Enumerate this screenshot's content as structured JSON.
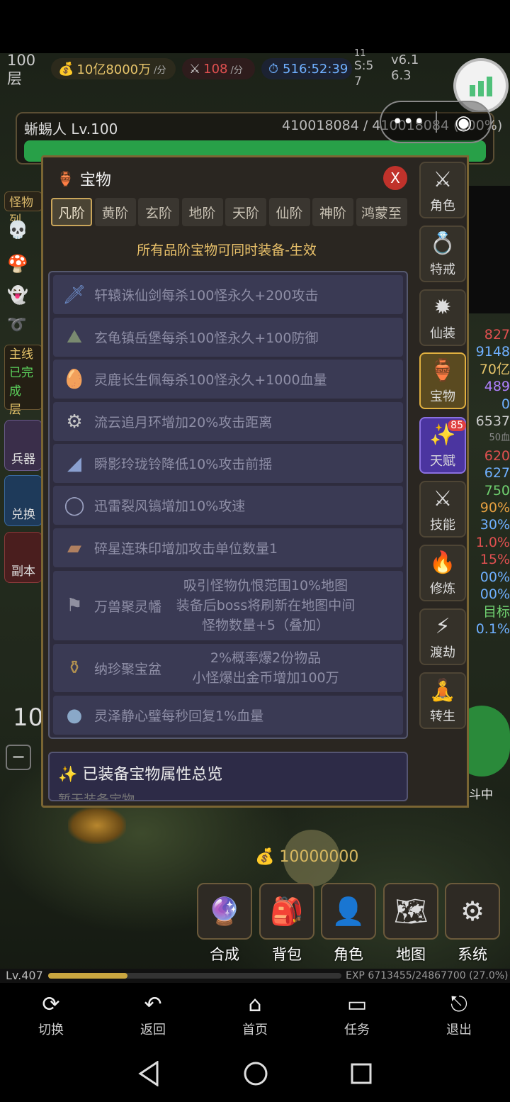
{
  "hud": {
    "floor": "100",
    "floor_unit": "层",
    "gold_rate": "10亿8000万",
    "gold_rate_unit": "/分",
    "kill_rate": "108",
    "kill_rate_unit": "/分",
    "timer": "516:52:39",
    "counter_top": "11",
    "counter_s": "S:5",
    "counter_bottom": "7",
    "version": "v6.1",
    "version2": "6.3"
  },
  "boss": {
    "name": "蜥蜴人 Lv.100",
    "hp_current": "410018084",
    "hp_max": "410018084",
    "hp_percent": "(100%)",
    "hp_fraction": 1.0
  },
  "left_side": {
    "monster_tab": "怪物列",
    "quest_title": "主线",
    "quest_status": "已完成",
    "quest_floor": "层",
    "weapon_label": "兵器",
    "exchange_label": "兑换",
    "copy_label": "副本",
    "left_num": "10",
    "minus": "−"
  },
  "right_stats": {
    "values": [
      "827",
      "9148",
      "70亿",
      "489",
      "0",
      "6537",
      "50血",
      "620",
      "627",
      "750",
      "90%",
      "30%",
      "1.0%",
      "15%",
      "00%",
      "00%",
      "目标",
      "0.1%"
    ],
    "battle_label": "斗中",
    "top_value": "100"
  },
  "modal": {
    "title": "宝物",
    "close_label": "X",
    "tabs": [
      "凡阶",
      "黄阶",
      "玄阶",
      "地阶",
      "天阶",
      "仙阶",
      "神阶",
      "鸿蒙至"
    ],
    "active_tab": "凡阶",
    "notice": "所有品阶宝物可同时装备-生效",
    "items": [
      {
        "icon": "sword-icon",
        "glyph": "🗡",
        "name": "轩辕诛仙剑",
        "desc": "每杀100怪永久+200攻击"
      },
      {
        "icon": "fortress-icon",
        "glyph": "⛰",
        "name": "玄龟镇岳堡",
        "desc": "每杀100怪永久+100防御"
      },
      {
        "icon": "jade-icon",
        "glyph": "🥚",
        "name": "灵鹿长生佩",
        "desc": "每杀100怪永久+1000血量"
      },
      {
        "icon": "ring-icon",
        "glyph": "⚙",
        "name": "流云追月环",
        "desc": "增加20%攻击距离"
      },
      {
        "icon": "bell-icon",
        "glyph": "◢",
        "name": "瞬影玲珑铃",
        "desc": "降低10%攻击前摇"
      },
      {
        "icon": "bracelet-icon",
        "glyph": "◯",
        "name": "迅雷裂风镐",
        "desc": "增加10%攻速"
      },
      {
        "icon": "seal-icon",
        "glyph": "▰",
        "name": "碎星连珠印",
        "desc": "增加攻击单位数量1"
      },
      {
        "icon": "banner-icon",
        "glyph": "⚑",
        "name": "万兽聚灵幡",
        "desc_lines": [
          "吸引怪物仇恨范围10%地图",
          "装备后boss将刷新在地图中间",
          "怪物数量+5（叠加）"
        ]
      },
      {
        "icon": "treasure-bowl-icon",
        "glyph": "⚱",
        "name": "纳珍聚宝盆",
        "desc_lines": [
          "2%概率爆2份物品",
          "小怪爆出金币增加100万"
        ]
      },
      {
        "icon": "jade-disc-icon",
        "glyph": "●",
        "name": "灵泽静心璧",
        "desc": "每秒回复1%血量"
      }
    ],
    "overview_title": "已装备宝物属性总览",
    "overview_sub": "暂无装备宝物"
  },
  "right_menu": [
    {
      "label": "角色",
      "glyph": "⚔",
      "icon": "crossed-swords-icon"
    },
    {
      "label": "特戒",
      "glyph": "💍",
      "icon": "ring-icon"
    },
    {
      "label": "仙装",
      "glyph": "✹",
      "icon": "sun-icon"
    },
    {
      "label": "宝物",
      "glyph": "🏺",
      "icon": "vase-icon"
    },
    {
      "label": "天赋",
      "glyph": "✨",
      "icon": "sparkle-icon",
      "badge": "85"
    },
    {
      "label": "技能",
      "glyph": "⚔",
      "icon": "crossed-swords-icon"
    },
    {
      "label": "修炼",
      "glyph": "🔥",
      "icon": "fire-icon"
    },
    {
      "label": "渡劫",
      "glyph": "⚡",
      "icon": "lightning-icon"
    },
    {
      "label": "转生",
      "glyph": "🧘",
      "icon": "meditation-icon"
    }
  ],
  "drop_gold": "10000000",
  "bottom_menu": [
    {
      "label": "合成",
      "glyph": "🔮",
      "icon": "crystal-ball-icon"
    },
    {
      "label": "背包",
      "glyph": "🎒",
      "icon": "backpack-icon"
    },
    {
      "label": "角色",
      "glyph": "👤",
      "icon": "person-icon"
    },
    {
      "label": "地图",
      "glyph": "🗺",
      "icon": "map-icon"
    },
    {
      "label": "系统",
      "glyph": "⚙",
      "icon": "gear-icon"
    }
  ],
  "exp": {
    "level": "Lv.407",
    "text": "EXP 6713455/24867700 (27.0%)",
    "fraction": 0.27
  },
  "app_nav": [
    {
      "label": "切换",
      "icon": "switch-icon"
    },
    {
      "label": "返回",
      "icon": "back-arrow-icon"
    },
    {
      "label": "首页",
      "icon": "home-icon"
    },
    {
      "label": "任务",
      "icon": "task-icon"
    },
    {
      "label": "退出",
      "icon": "exit-icon"
    }
  ]
}
